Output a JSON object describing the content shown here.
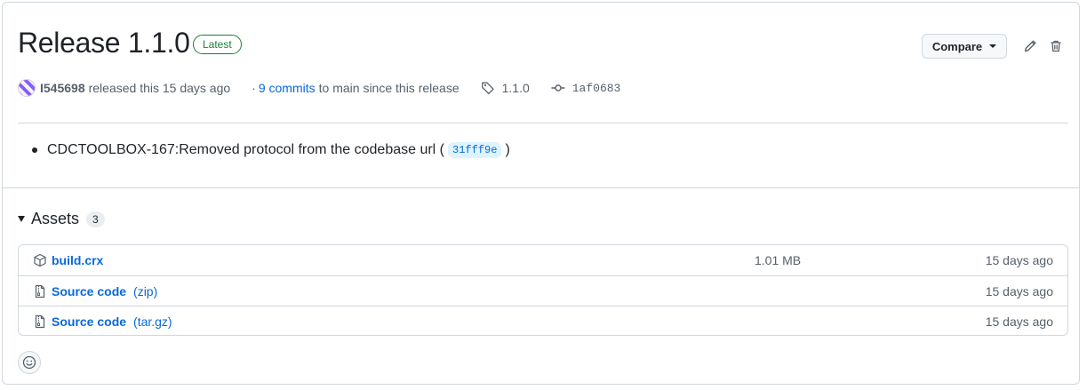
{
  "release": {
    "title": "Release 1.1.0",
    "badge": "Latest"
  },
  "actions": {
    "compare_label": "Compare",
    "edit_icon": "pencil-icon",
    "delete_icon": "trash-icon"
  },
  "meta": {
    "author": "I545698",
    "released_text": "released this 15 days ago",
    "commits_prefix": "·",
    "commits_link": "9 commits",
    "commits_suffix": "to main since this release",
    "tag": "1.1.0",
    "commit_sha": "1af0683"
  },
  "notes": {
    "items": [
      {
        "text_before": "CDCTOOLBOX-167:Removed protocol from the codebase url (",
        "sha": "31fff9e",
        "text_after": ")"
      }
    ]
  },
  "assets": {
    "heading": "Assets",
    "count": "3",
    "rows": [
      {
        "icon": "package-icon",
        "name": "build.crx",
        "ext": "",
        "size": "1.01 MB",
        "date": "15 days ago"
      },
      {
        "icon": "file-zip-icon",
        "name": "Source code",
        "ext": "(zip)",
        "size": "",
        "date": "15 days ago"
      },
      {
        "icon": "file-zip-icon",
        "name": "Source code",
        "ext": "(tar.gz)",
        "size": "",
        "date": "15 days ago"
      }
    ]
  },
  "reactions": {
    "icon": "smiley-icon"
  },
  "colors": {
    "accent": "#0969da",
    "success": "#1a7f37",
    "border": "#d0d7de",
    "muted": "#57606a"
  }
}
